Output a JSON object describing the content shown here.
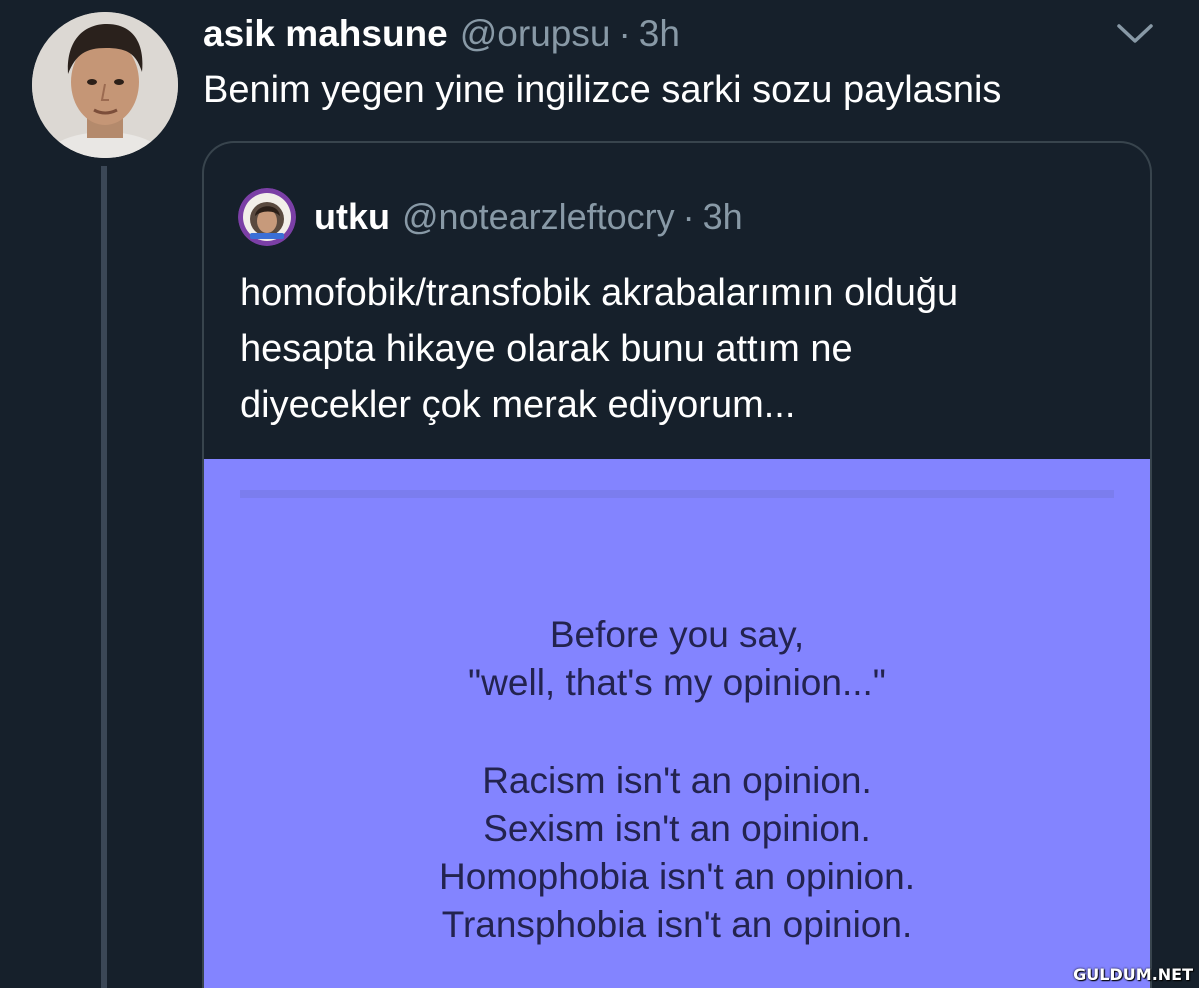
{
  "tweet": {
    "author_name": "asik mahsune",
    "author_handle": "@orupsu",
    "separator": "·",
    "time": "3h",
    "text": "Benim yegen yine ingilizce sarki sozu paylasnis",
    "avatar_icon": "profile-photo",
    "menu_icon": "chevron-down-icon"
  },
  "quote": {
    "author_name": "utku",
    "author_handle": "@notearzleftocry",
    "separator": "·",
    "time": "3h",
    "text_lines": [
      "homofobik/transfobik akrabalarımın olduğu",
      "hesapta hikaye olarak bunu attım ne",
      "diyecekler çok merak ediyorum..."
    ],
    "media": {
      "background_color": "#8384ff",
      "lines_group_1": [
        "Before you say,",
        "\"well, that's my opinion...\""
      ],
      "lines_group_2": [
        "Racism isn't an opinion.",
        "Sexism isn't an opinion.",
        "Homophobia isn't an opinion.",
        "Transphobia isn't an opinion."
      ]
    }
  },
  "watermark": "GULDUM.NET",
  "colors": {
    "background": "#16202b",
    "secondary_text": "#8899a6",
    "border": "#38444d",
    "thread_line": "#3b4756",
    "media_text": "#23234f"
  }
}
